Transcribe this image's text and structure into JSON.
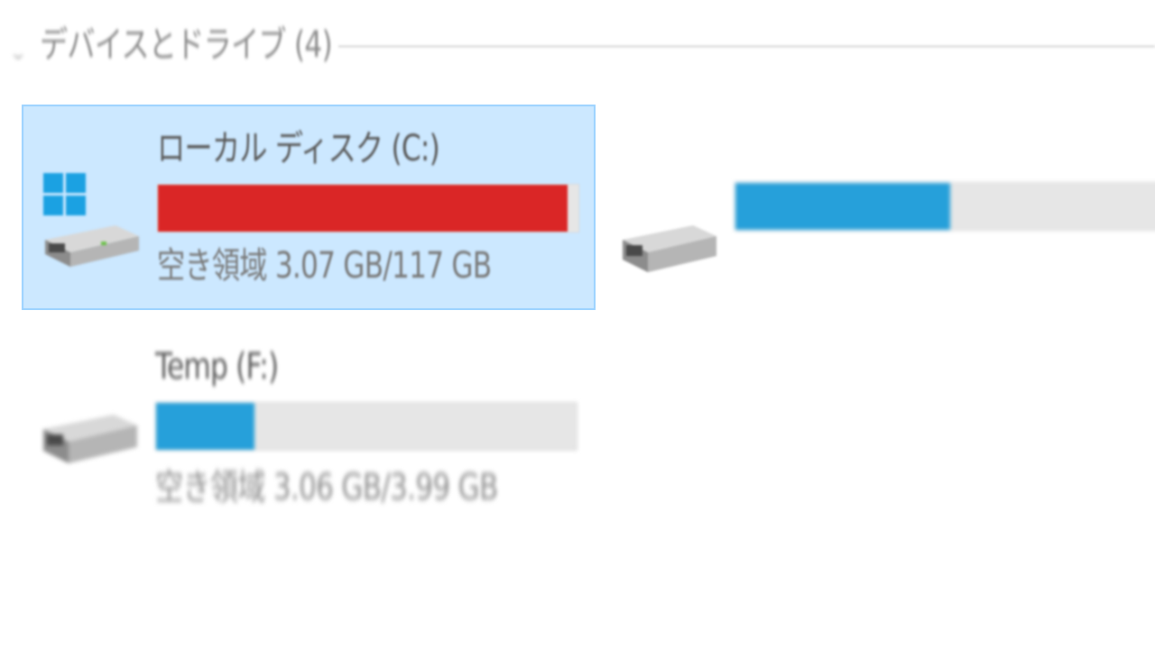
{
  "section": {
    "title": "デバイスとドライブ (4)",
    "collapse_icon": "chevron-down-icon"
  },
  "drives": [
    {
      "name": "ローカル ディスク (C:)",
      "free_text": "空き領域 3.07 GB/117 GB",
      "used_fraction": 0.974,
      "bar_color": "#da2626",
      "icon": "windows-system-drive-icon",
      "selected": true
    },
    {
      "name": "",
      "free_text": "",
      "used_fraction": 0.5,
      "bar_color": "#26a0da",
      "icon": "hard-drive-icon",
      "selected": false
    },
    {
      "name": "Temp (F:)",
      "free_text": "空き領域 3.06 GB/3.99 GB",
      "used_fraction": 0.233,
      "bar_color": "#26a0da",
      "icon": "hard-drive-icon",
      "selected": false
    }
  ]
}
